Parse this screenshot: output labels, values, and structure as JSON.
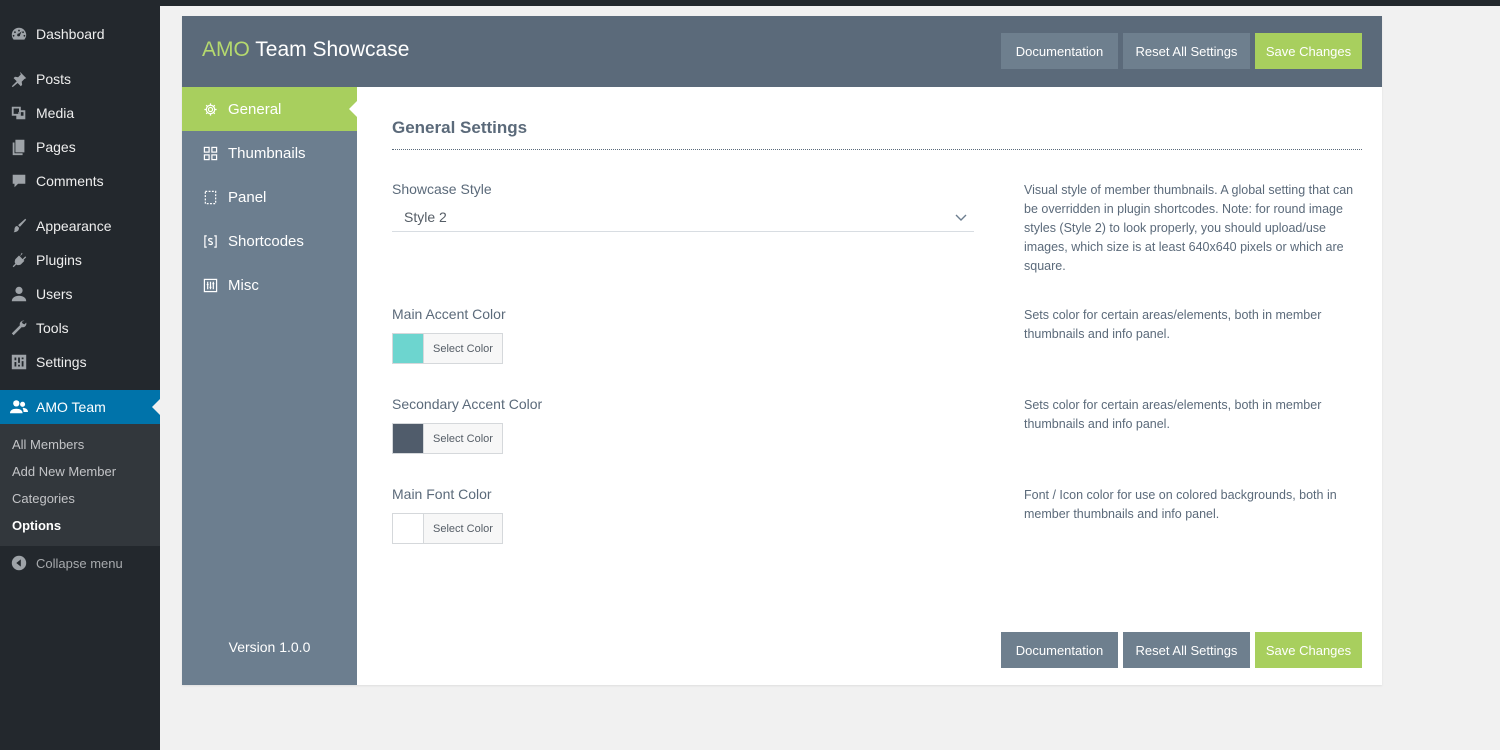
{
  "wp_menu": {
    "items": [
      {
        "label": "Dashboard",
        "icon": "dashboard-icon"
      },
      {
        "label": "Posts",
        "icon": "pin-icon"
      },
      {
        "label": "Media",
        "icon": "media-icon"
      },
      {
        "label": "Pages",
        "icon": "pages-icon"
      },
      {
        "label": "Comments",
        "icon": "comment-icon"
      },
      {
        "label": "Appearance",
        "icon": "brush-icon"
      },
      {
        "label": "Plugins",
        "icon": "plug-icon"
      },
      {
        "label": "Users",
        "icon": "user-icon"
      },
      {
        "label": "Tools",
        "icon": "wrench-icon"
      },
      {
        "label": "Settings",
        "icon": "sliders-icon"
      },
      {
        "label": "AMO Team",
        "icon": "team-icon"
      }
    ],
    "submenu": [
      "All Members",
      "Add New Member",
      "Categories",
      "Options"
    ],
    "collapse_label": "Collapse menu"
  },
  "header": {
    "brand_accent": "AMO",
    "brand_rest": " Team Showcase",
    "documentation": "Documentation",
    "reset": "Reset All Settings",
    "save": "Save Changes"
  },
  "side_nav": {
    "items": [
      {
        "label": "General",
        "icon": "gear-icon"
      },
      {
        "label": "Thumbnails",
        "icon": "grid-icon"
      },
      {
        "label": "Panel",
        "icon": "panel-icon"
      },
      {
        "label": "Shortcodes",
        "icon": "shortcode-icon"
      },
      {
        "label": "Misc",
        "icon": "misc-icon"
      }
    ],
    "version": "Version 1.0.0"
  },
  "content": {
    "title": "General Settings",
    "showcase_style": {
      "label": "Showcase Style",
      "value": "Style 2",
      "desc": "Visual style of member thumbnails. A global setting that can be overridden in plugin shortcodes. Note: for round image styles (Style 2) to look properly, you should upload/use images, which size is at least 640x640 pixels or which are square."
    },
    "main_accent": {
      "label": "Main Accent Color",
      "button": "Select Color",
      "color": "#6dd5cf",
      "desc": "Sets color for certain areas/elements, both in member thumbnails and info panel."
    },
    "secondary_accent": {
      "label": "Secondary Accent Color",
      "button": "Select Color",
      "color": "#505c6b",
      "desc": "Sets color for certain areas/elements, both in member thumbnails and info panel."
    },
    "main_font": {
      "label": "Main Font Color",
      "button": "Select Color",
      "color": "#ffffff",
      "desc": "Font / Icon color for use on colored backgrounds, both in member thumbnails and info panel."
    }
  },
  "footer": {
    "documentation": "Documentation",
    "reset": "Reset All Settings",
    "save": "Save Changes"
  }
}
